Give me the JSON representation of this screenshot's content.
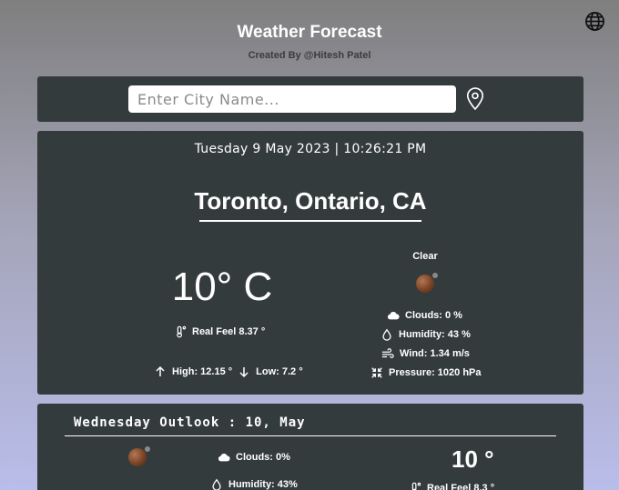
{
  "header": {
    "title": "Weather Forecast",
    "subtitle": "Created By @Hitesh Patel"
  },
  "search": {
    "placeholder": "Enter City Name...",
    "value": ""
  },
  "current": {
    "datetime": "Tuesday 9 May 2023 | 10:26:21 PM",
    "city": "Toronto, Ontario, CA",
    "temperature": "10° C",
    "real_feel": "Real Feel 8.37 °",
    "high": "High: 12.15 °",
    "low": "Low: 7.2 °",
    "condition": "Clear",
    "clouds": "Clouds: 0 %",
    "humidity": "Humidity: 43 %",
    "wind": "Wind: 1.34 m/s",
    "pressure": "Pressure: 1020 hPa"
  },
  "outlook": {
    "title": "Wednesday Outlook : 10, May",
    "clouds": "Clouds: 0%",
    "humidity": "Humidity: 43%",
    "temperature": "10 °",
    "real_feel": "Real Feel 8.3 °"
  },
  "icons": {
    "globe": "globe-icon",
    "location": "map-pin-icon",
    "thermometer": "thermometer-icon",
    "cloud": "cloud-icon",
    "humidity": "droplet-icon",
    "wind": "wind-icon",
    "pressure": "compress-icon",
    "weather": "clear-night-icon"
  },
  "colors": {
    "card": "#343b3c",
    "text": "#ffffff"
  }
}
